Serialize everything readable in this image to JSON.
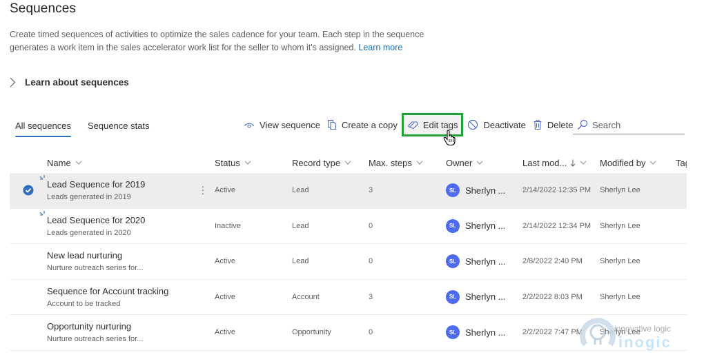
{
  "page": {
    "title": "Sequences",
    "description": "Create timed sequences of activities to optimize the sales cadence for your team. Each step in the sequence generates a work item in the sales accelerator work list for the seller to whom it's assigned.",
    "learn_more": "Learn more",
    "learn_about": "Learn about sequences"
  },
  "tabs": [
    {
      "label": "All sequences",
      "active": true
    },
    {
      "label": "Sequence stats",
      "active": false
    }
  ],
  "toolbar": {
    "view_sequence": "View sequence",
    "create_copy": "Create a copy",
    "edit_tags": "Edit tags",
    "deactivate": "Deactivate",
    "delete": "Delete",
    "search_placeholder": "Search"
  },
  "columns": {
    "name": "Name",
    "status": "Status",
    "record_type": "Record type",
    "max_steps": "Max. steps",
    "owner": "Owner",
    "last_modified": "Last mod...",
    "modified_by": "Modified by",
    "tags": "Tag"
  },
  "rows": [
    {
      "name": "Lead Sequence for 2019",
      "desc": "Leads generated in 2019",
      "status": "Active",
      "record_type": "Lead",
      "max_steps": "3",
      "owner_initials": "SL",
      "owner": "Sherlyn ...",
      "last_modified": "2/14/2022 12:35 PM",
      "modified_by": "Sherlyn Lee",
      "selected": true,
      "new": true
    },
    {
      "name": "Lead Sequence for 2020",
      "desc": "Leads generated in 2020",
      "status": "Inactive",
      "record_type": "Lead",
      "max_steps": "0",
      "owner_initials": "SL",
      "owner": "Sherlyn ...",
      "last_modified": "2/14/2022 12:34 PM",
      "modified_by": "Sherlyn Lee",
      "selected": false,
      "new": true
    },
    {
      "name": "New lead nurturing",
      "desc": "Nurture outreach series for...",
      "status": "Active",
      "record_type": "Lead",
      "max_steps": "0",
      "owner_initials": "SL",
      "owner": "Sherlyn ...",
      "last_modified": "2/8/2022 2:40 PM",
      "modified_by": "Sherlyn Lee",
      "selected": false,
      "new": false
    },
    {
      "name": "Sequence for Account tracking",
      "desc": "Account to be tracked",
      "status": "Active",
      "record_type": "Account",
      "max_steps": "3",
      "owner_initials": "SL",
      "owner": "Sherlyn ...",
      "last_modified": "2/2/2022 8:03 PM",
      "modified_by": "Sherlyn Lee",
      "selected": false,
      "new": false
    },
    {
      "name": "Opportunity nurturing",
      "desc": "Nurture outreach series for...",
      "status": "Active",
      "record_type": "Opportunity",
      "max_steps": "0",
      "owner_initials": "SL",
      "owner": "Sherlyn ...",
      "last_modified": "2/2/2022 7:47 PM",
      "modified_by": "Sherlyn Lee",
      "selected": false,
      "new": false
    }
  ],
  "watermark": {
    "tagline": "innovative logic",
    "brand": "inogic"
  },
  "colors": {
    "accent": "#2f6ebf",
    "highlight_box": "#22a33a",
    "avatar": "#4f6bed",
    "link": "#0f6cbd"
  }
}
